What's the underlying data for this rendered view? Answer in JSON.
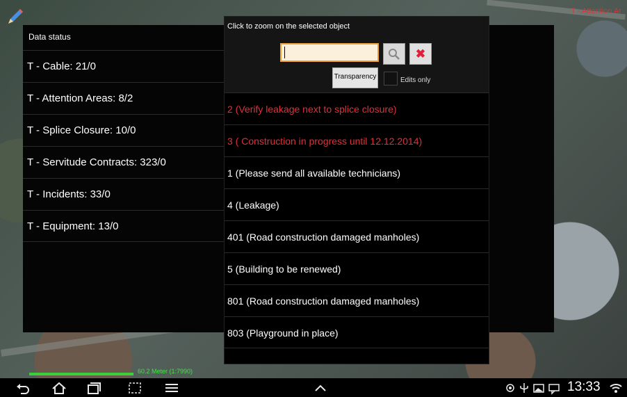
{
  "map": {
    "top_right_label": "T - Attention Ar"
  },
  "status_panel": {
    "title": "Data status",
    "items": [
      {
        "label": "T - Cable: 21/0"
      },
      {
        "label": "T - Attention Areas: 8/2"
      },
      {
        "label": "T - Splice Closure: 10/0"
      },
      {
        "label": "T - Servitude Contracts: 323/0"
      },
      {
        "label": "T - Incidents: 33/0"
      },
      {
        "label": "T - Equipment: 13/0"
      }
    ]
  },
  "popup": {
    "hint": "Click to zoom on the selected object",
    "search": {
      "value": "",
      "placeholder": ""
    },
    "transparency_label": "Transparency",
    "edits_only_label": "Edits only",
    "results": [
      {
        "label": "2 (Verify leakage next to splice closure)",
        "color": "#e0303a"
      },
      {
        "label": "3 ( Construction in progress until 12.12.2014)",
        "color": "#e0303a"
      },
      {
        "label": "1 (Please send all available technicians)",
        "color": "#ffffff"
      },
      {
        "label": "4 (Leakage)",
        "color": "#ffffff"
      },
      {
        "label": "401 (Road construction damaged manholes)",
        "color": "#ffffff"
      },
      {
        "label": "5 (Building to be renewed)",
        "color": "#ffffff"
      },
      {
        "label": "801 (Road construction damaged manholes)",
        "color": "#ffffff"
      },
      {
        "label": "803 (Playground in place)",
        "color": "#ffffff"
      }
    ]
  },
  "scale": {
    "text": "60.2 Meter (1:7990)"
  },
  "statusbar": {
    "time": "13:33"
  },
  "icons": {
    "pencil": "pencil-icon",
    "search": "magnifier-icon",
    "clear": "close-icon",
    "back": "back-icon",
    "home": "home-icon",
    "recent": "recent-apps-icon",
    "screenshot": "screenshot-icon",
    "menu": "menu-icon",
    "up": "chevron-up-icon",
    "gps": "gps-icon",
    "usb": "usb-icon",
    "image": "image-icon",
    "notification": "notification-icon",
    "wifi": "wifi-icon"
  }
}
